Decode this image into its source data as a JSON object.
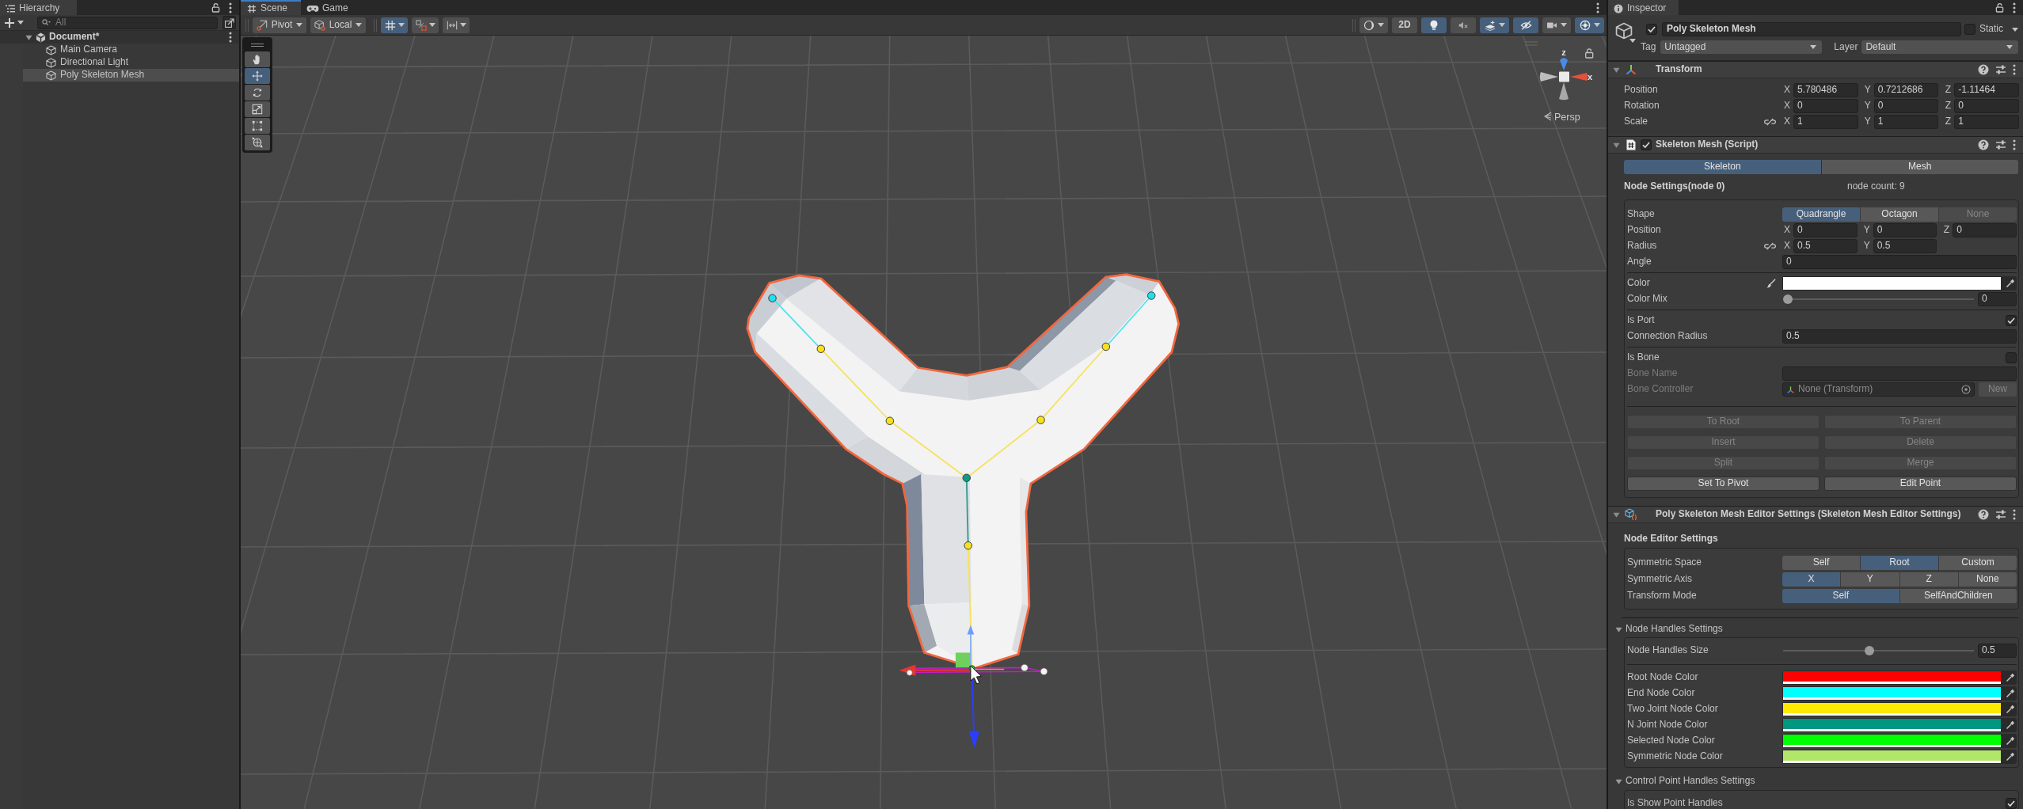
{
  "hierarchy": {
    "tab": "Hierarchy",
    "search": {
      "placeholder": "All"
    },
    "scenes": [
      {
        "label": "Document*",
        "expanded": true,
        "children": [
          {
            "label": "Main Camera",
            "selected": false
          },
          {
            "label": "Directional Light",
            "selected": false
          },
          {
            "label": "Poly Skeleton Mesh",
            "selected": true
          }
        ]
      }
    ]
  },
  "scene_view": {
    "tabs": [
      {
        "label": "Scene",
        "kind": "scene",
        "selected": true
      },
      {
        "label": "Game",
        "kind": "game",
        "selected": false
      }
    ],
    "pivot_mode": "Pivot",
    "pivot_rotation": "Local",
    "snap_buttons": [
      {
        "kind": "grid",
        "on": true
      },
      {
        "kind": "increment",
        "on": false
      },
      {
        "kind": "align",
        "on": false
      }
    ],
    "view_buttons": [
      {
        "kind": "shading",
        "on": false
      },
      {
        "kind": "dimension",
        "label": "2D",
        "on": false
      },
      {
        "kind": "lighting",
        "on": true
      },
      {
        "kind": "audio",
        "on": false
      },
      {
        "kind": "effects",
        "on": true
      },
      {
        "kind": "visibility",
        "on": true
      },
      {
        "kind": "camera",
        "on": false
      },
      {
        "kind": "gizmos",
        "on": true
      }
    ],
    "tools": [
      {
        "kind": "hand",
        "selected": false
      },
      {
        "kind": "move",
        "selected": true
      },
      {
        "kind": "rotate",
        "selected": false
      },
      {
        "kind": "scale",
        "selected": false
      },
      {
        "kind": "rect",
        "selected": false
      },
      {
        "kind": "transform",
        "selected": false
      }
    ],
    "orientation_gizmo": {
      "axis_labels": [
        "z",
        "x"
      ],
      "projection": "Persp"
    }
  },
  "inspector": {
    "tab": "Inspector",
    "object": {
      "active": true,
      "name": "Poly Skeleton Mesh",
      "static": false,
      "static_label": "Static",
      "tag_label": "Tag",
      "tag": "Untagged",
      "layer_label": "Layer",
      "layer": "Default"
    },
    "transform": {
      "title": "Transform",
      "expanded": true,
      "rows": [
        {
          "label": "Position",
          "fields": [
            {
              "axis": "X",
              "value": "5.780486"
            },
            {
              "axis": "Y",
              "value": "0.7212686"
            },
            {
              "axis": "Z",
              "value": "-1.11464"
            }
          ]
        },
        {
          "label": "Rotation",
          "fields": [
            {
              "axis": "X",
              "value": "0"
            },
            {
              "axis": "Y",
              "value": "0"
            },
            {
              "axis": "Z",
              "value": "0"
            }
          ]
        },
        {
          "label": "Scale",
          "linked": false,
          "fields": [
            {
              "axis": "X",
              "value": "1"
            },
            {
              "axis": "Y",
              "value": "1"
            },
            {
              "axis": "Z",
              "value": "1"
            }
          ]
        }
      ]
    },
    "skeleton_mesh": {
      "title": "Skeleton Mesh (Script)",
      "enabled": true,
      "expanded": true,
      "tabs": [
        {
          "label": "Skeleton",
          "selected": true
        },
        {
          "label": "Mesh",
          "selected": false
        }
      ],
      "heading": "Node Settings(node 0)",
      "node_count": "node count: 9",
      "groups": [
        {
          "rows": [
            {
              "kind": "choice",
              "label": "Shape",
              "disabled": false,
              "options": [
                {
                  "label": "Quadrangle",
                  "selected": true,
                  "disabled": false
                },
                {
                  "label": "Octagon",
                  "selected": false,
                  "disabled": false
                },
                {
                  "label": "None",
                  "selected": false,
                  "disabled": true
                }
              ]
            },
            {
              "kind": "vector",
              "label": "Position",
              "disabled": false,
              "fields": [
                {
                  "axis": "X",
                  "value": "0"
                },
                {
                  "axis": "Y",
                  "value": "0"
                },
                {
                  "axis": "Z",
                  "value": "0"
                }
              ]
            },
            {
              "kind": "vector",
              "label": "Radius",
              "disabled": false,
              "linked": false,
              "fields": [
                {
                  "axis": "X",
                  "value": "0.5"
                },
                {
                  "axis": "Y",
                  "value": "0.5"
                }
              ]
            },
            {
              "kind": "number",
              "label": "Angle",
              "disabled": false,
              "value": "0"
            }
          ]
        },
        {
          "rows": [
            {
              "kind": "paint",
              "label": "Color",
              "disabled": false,
              "color": "#ffffff"
            },
            {
              "kind": "slider",
              "label": "Color Mix",
              "disabled": false,
              "level": 0,
              "value": "0"
            }
          ]
        },
        {
          "rows": [
            {
              "kind": "toggle",
              "label": "Is Port",
              "disabled": false,
              "checked": true
            },
            {
              "kind": "number",
              "label": "Connection Radius",
              "disabled": false,
              "value": "0.5"
            }
          ]
        },
        {
          "rows": [
            {
              "kind": "toggle",
              "label": "Is Bone",
              "disabled": false,
              "checked": false
            },
            {
              "kind": "text",
              "label": "Bone Name",
              "disabled": true
            },
            {
              "kind": "object",
              "label": "Bone Controller",
              "disabled": true,
              "value": "None (Transform)",
              "button": "New"
            }
          ]
        }
      ],
      "button_rows": [
        [
          {
            "label": "To Root",
            "disabled": true
          },
          {
            "label": "To Parent",
            "disabled": true
          }
        ],
        [
          {
            "label": "Insert",
            "disabled": true
          },
          {
            "label": "Delete",
            "disabled": true
          }
        ],
        [
          {
            "label": "Split",
            "disabled": true
          },
          {
            "label": "Merge",
            "disabled": true
          }
        ],
        [
          {
            "label": "Set To Pivot",
            "disabled": false
          },
          {
            "label": "Edit Point",
            "disabled": false
          }
        ]
      ]
    },
    "editor_settings": {
      "title": "Poly Skeleton Mesh Editor Settings (Skeleton Mesh Editor Settings)",
      "expanded": true,
      "sections": [
        {
          "kind": "heading",
          "title": "Node Editor Settings",
          "groups": [
            {
              "rows": [
                {
                  "kind": "choice",
                  "label": "Symmetric Space",
                  "options": [
                    {
                      "label": "Self",
                      "selected": false
                    },
                    {
                      "label": "Root",
                      "selected": true
                    },
                    {
                      "label": "Custom",
                      "selected": false
                    }
                  ]
                },
                {
                  "kind": "choice",
                  "label": "Symmetric Axis",
                  "options": [
                    {
                      "label": "X",
                      "selected": true
                    },
                    {
                      "label": "Y",
                      "selected": false
                    },
                    {
                      "label": "Z",
                      "selected": false
                    },
                    {
                      "label": "None",
                      "selected": false
                    }
                  ]
                },
                {
                  "kind": "choice",
                  "label": "Transform Mode",
                  "options": [
                    {
                      "label": "Self",
                      "selected": true
                    },
                    {
                      "label": "SelfAndChildren",
                      "selected": false
                    }
                  ]
                }
              ]
            }
          ]
        },
        {
          "kind": "foldout",
          "title": "Node Handles Settings",
          "expanded": true,
          "groups": [
            {
              "rows": [
                {
                  "kind": "slider",
                  "label": "Node Handles Size",
                  "level": 0.45,
                  "value": "0.5"
                }
              ]
            },
            {
              "rows": [
                {
                  "kind": "color",
                  "label": "Root Node Color",
                  "color": "#ff0000"
                },
                {
                  "kind": "color",
                  "label": "End Node Color",
                  "color": "#00ffff"
                },
                {
                  "kind": "color",
                  "label": "Two Joint Node Color",
                  "color": "#ffea00"
                },
                {
                  "kind": "color",
                  "label": "N Joint Node Color",
                  "color": "#00967f"
                },
                {
                  "kind": "color",
                  "label": "Selected Node Color",
                  "color": "#00ff00"
                },
                {
                  "kind": "color",
                  "label": "Symmetric Node Color",
                  "color": "#b2e66a"
                }
              ]
            }
          ]
        },
        {
          "kind": "foldout",
          "title": "Control Point Handles Settings",
          "expanded": true,
          "groups": [
            {
              "rows": [
                {
                  "kind": "toggle",
                  "label": "Is Show Point Handles",
                  "checked": true
                }
              ]
            }
          ]
        }
      ]
    }
  }
}
